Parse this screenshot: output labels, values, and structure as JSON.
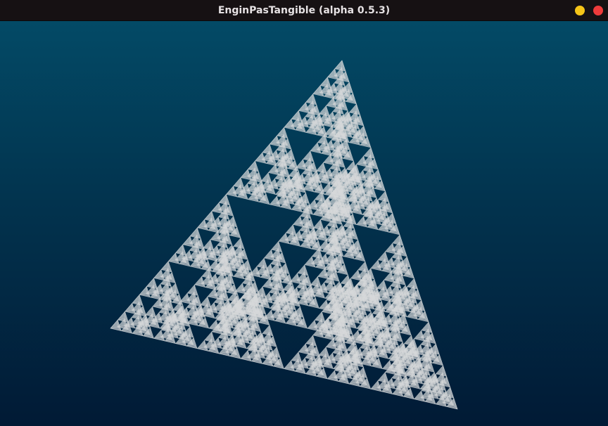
{
  "window": {
    "title": "EnginPasTangible (alpha 0.5.3)"
  },
  "controls": {
    "minimize_color": "#f5c518",
    "close_color": "#ef3b3b"
  },
  "scene": {
    "object": "sierpinski-tetrahedron",
    "background_top": "#034a66",
    "background_bottom": "#011a35",
    "fractal_color": "#d7d9db"
  }
}
